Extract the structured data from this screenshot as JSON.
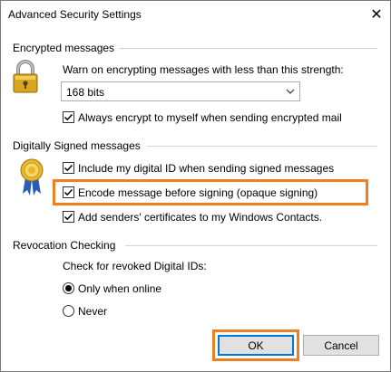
{
  "window": {
    "title": "Advanced Security Settings",
    "close_glyph": "✕"
  },
  "encrypted": {
    "heading": "Encrypted messages",
    "icon": "padlock-icon",
    "warn_label": "Warn on encrypting messages with less than this strength:",
    "strength_value": "168 bits",
    "always_encrypt_label": "Always encrypt to myself when sending encrypted mail",
    "always_encrypt_checked": true
  },
  "signed": {
    "heading": "Digitally Signed messages",
    "icon": "certificate-ribbon-icon",
    "include_id_label": "Include my digital ID when sending signed messages",
    "include_id_checked": true,
    "encode_label": "Encode message before signing (opaque signing)",
    "encode_checked": true,
    "add_certs_label": "Add senders' certificates to my Windows Contacts.",
    "add_certs_checked": true
  },
  "revocation": {
    "heading": "Revocation Checking",
    "check_label": "Check for revoked Digital IDs:",
    "options": [
      "Only when online",
      "Never"
    ],
    "selected": "Only when online"
  },
  "buttons": {
    "ok": "OK",
    "cancel": "Cancel"
  },
  "colors": {
    "highlight": "#f07f21",
    "default_button_border": "#0078d7"
  }
}
